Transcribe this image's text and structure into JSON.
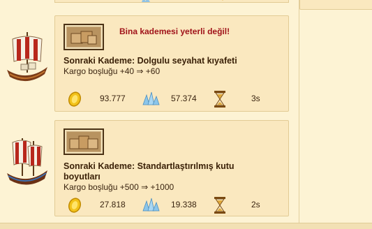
{
  "cards": [
    {
      "warning": "Bina kademesi yeterli değil!",
      "next_level": "Sonraki Kademe: Dolgulu seyahat kıyafeti",
      "cargo": "Kargo boşluğu +40 ⇒ +60",
      "gold": "93.777",
      "crystal": "57.374",
      "time": "3s"
    },
    {
      "next_level": "Sonraki Kademe: Standartlaştırılmış kutu boyutları",
      "cargo": "Kargo boşluğu +500 ⇒ +1000",
      "gold": "27.818",
      "crystal": "19.338",
      "time": "2s"
    }
  ],
  "icons": {
    "gold": "gold-coin-icon",
    "crystal": "crystal-icon",
    "time": "hourglass-icon",
    "ship": "ship-icon",
    "upgrade": "crates-icon"
  },
  "colors": {
    "warning": "#a0131a",
    "card_bg": "#fae8bf",
    "page_bg": "#fdf3d4"
  }
}
